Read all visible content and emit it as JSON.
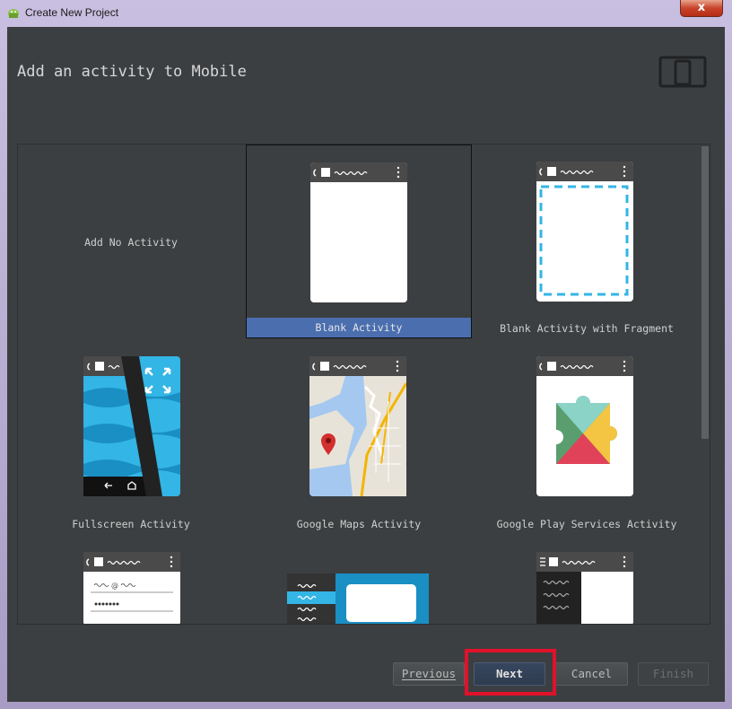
{
  "window": {
    "title": "Create New Project",
    "close_label": "x"
  },
  "header": {
    "title": "Add an activity to Mobile",
    "device_icon": "phone-tablet-icon"
  },
  "gallery": {
    "items": [
      {
        "label": "Add No Activity",
        "selected": false
      },
      {
        "label": "Blank Activity",
        "selected": true
      },
      {
        "label": "Blank Activity with Fragment",
        "selected": false
      },
      {
        "label": "Fullscreen Activity",
        "selected": false
      },
      {
        "label": "Google Maps Activity",
        "selected": false
      },
      {
        "label": "Google Play Services Activity",
        "selected": false
      }
    ]
  },
  "buttons": {
    "previous": "Previous",
    "next": "Next",
    "cancel": "Cancel",
    "finish": "Finish"
  },
  "colors": {
    "selection": "#4b6eaf",
    "highlight": "#e0122a",
    "background": "#3c3f41"
  }
}
